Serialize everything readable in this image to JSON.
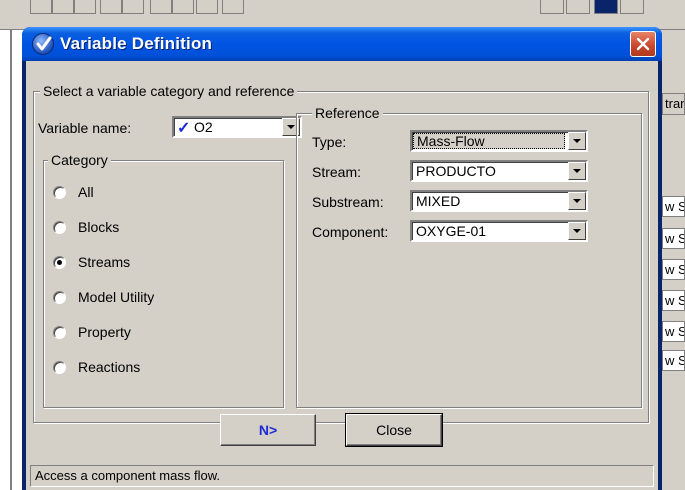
{
  "background": {
    "side_cells": [
      "w S",
      "w S",
      "w S",
      "w S",
      "w S",
      "w S"
    ],
    "column_header": "tran"
  },
  "dialog": {
    "title": "Variable Definition",
    "outer_group_title": "Select a variable category and reference",
    "variable_name": {
      "label": "Variable name:",
      "value": "O2"
    },
    "category": {
      "title": "Category",
      "options": [
        {
          "label": "All",
          "checked": false
        },
        {
          "label": "Blocks",
          "checked": false
        },
        {
          "label": "Streams",
          "checked": true
        },
        {
          "label": "Model Utility",
          "checked": false
        },
        {
          "label": "Property",
          "checked": false
        },
        {
          "label": "Reactions",
          "checked": false
        }
      ]
    },
    "reference": {
      "title": "Reference",
      "fields": [
        {
          "label": "Type:",
          "value": "Mass-Flow"
        },
        {
          "label": "Stream:",
          "value": "PRODUCTO"
        },
        {
          "label": "Substream:",
          "value": "MIXED"
        },
        {
          "label": "Component:",
          "value": "OXYGE-01"
        }
      ]
    },
    "buttons": {
      "next_label": "N>",
      "close_label": "Close"
    },
    "status_text": "Access a component mass flow."
  }
}
